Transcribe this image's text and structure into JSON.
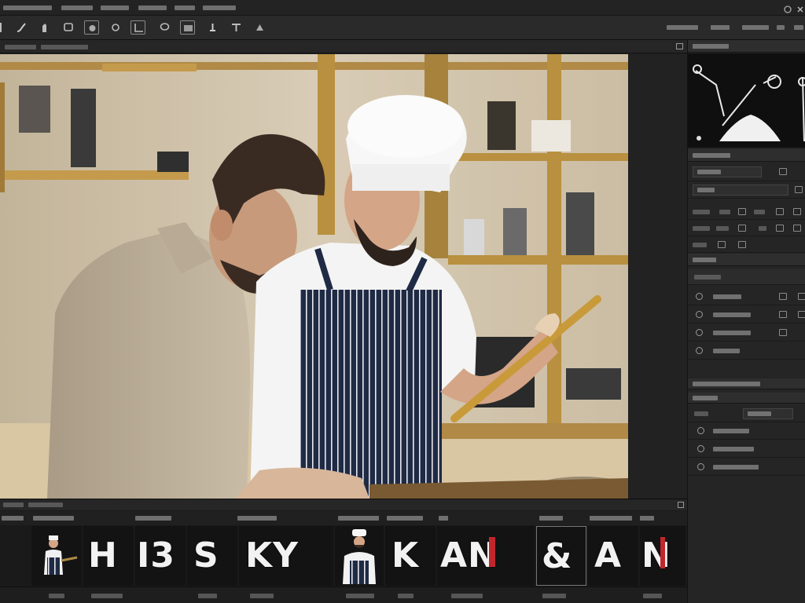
{
  "filmstrip": {
    "items": [
      {
        "glyph": ""
      },
      {
        "glyph": "H"
      },
      {
        "glyph": "I3"
      },
      {
        "glyph": "S"
      },
      {
        "glyph": "KY"
      },
      {
        "glyph": ""
      },
      {
        "glyph": "K"
      },
      {
        "glyph": "AN"
      },
      {
        "glyph": "&"
      },
      {
        "glyph": "A"
      },
      {
        "glyph": "N"
      }
    ]
  },
  "colors": {
    "app_bg": "#1c1c1c",
    "panel_bg": "#252525",
    "header_bg": "#2e2e2e",
    "text": "#c8c8c8"
  },
  "icons": [
    "layer-visibility-icon",
    "layer-lock-icon",
    "minimize-icon",
    "close-icon",
    "panel-menu-icon"
  ]
}
